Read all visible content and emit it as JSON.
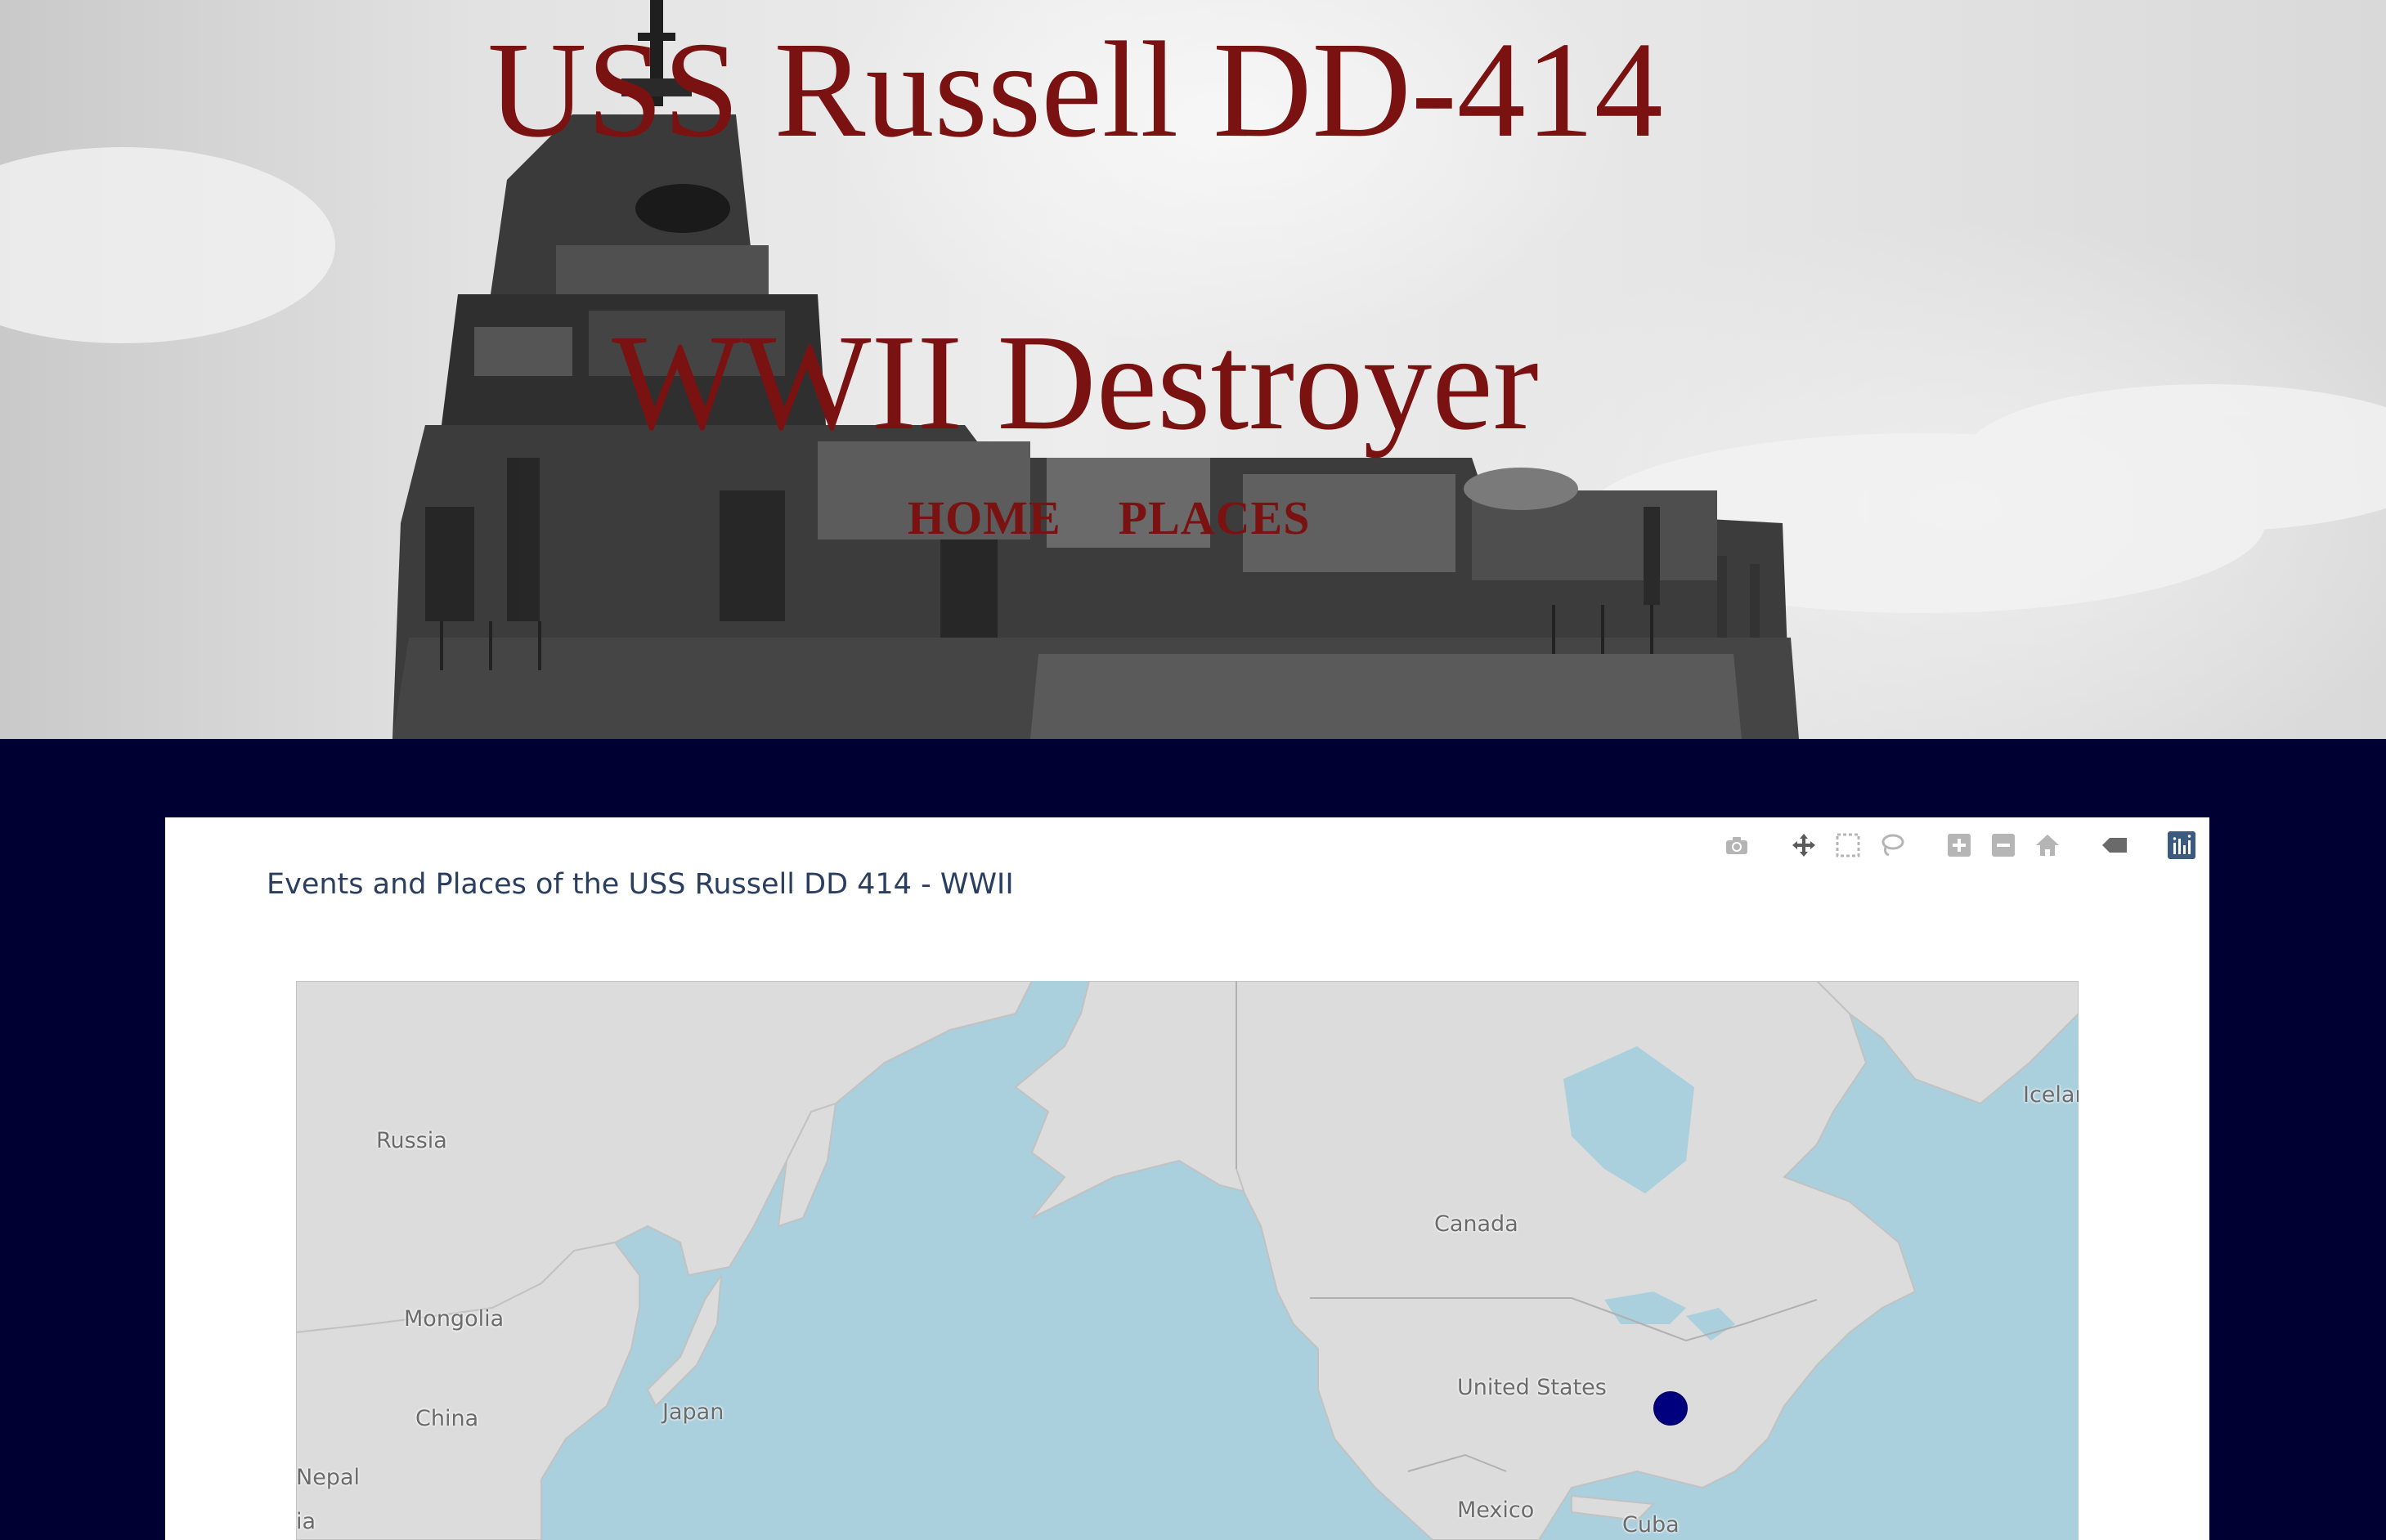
{
  "hero": {
    "title": "USS Russell DD-414",
    "subtitle": "WWII Destroyer",
    "nav": [
      {
        "label": "HOME"
      },
      {
        "label": "PLACES"
      }
    ]
  },
  "plot": {
    "title": "Events and Places of the USS Russell DD 414 - WWII",
    "modebar": [
      "camera-icon",
      "pan-icon",
      "box-select-icon",
      "lasso-icon",
      "zoom-in-icon",
      "zoom-out-icon",
      "reset-home-icon",
      "hover-spike-icon",
      "plotly-logo-icon"
    ],
    "map": {
      "labels": [
        {
          "name": "Russia"
        },
        {
          "name": "Mongolia"
        },
        {
          "name": "China"
        },
        {
          "name": "Japan"
        },
        {
          "name": "Nepal"
        },
        {
          "name": "ia"
        },
        {
          "name": "Canada"
        },
        {
          "name": "United States"
        },
        {
          "name": "Mexico"
        },
        {
          "name": "Cuba"
        },
        {
          "name": "Icelar"
        }
      ],
      "marker_color": "#00007f"
    }
  },
  "colors": {
    "title": "#7a1212",
    "page_background": "#000033",
    "ocean": "#aacfdd",
    "land": "#dcdcdc"
  }
}
